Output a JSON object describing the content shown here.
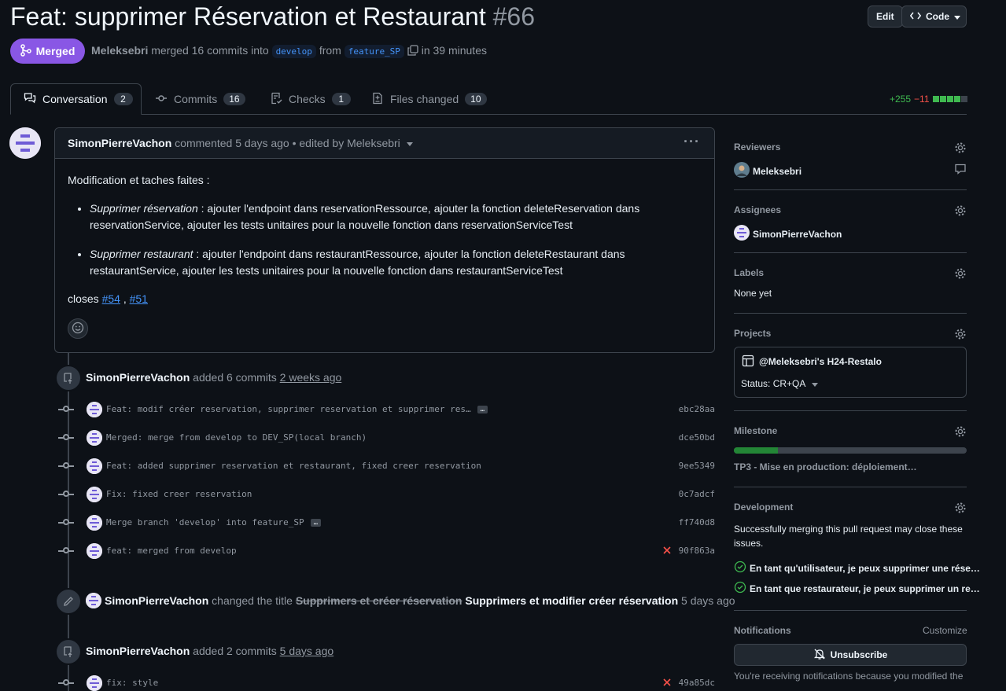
{
  "header": {
    "title": "Feat: supprimer Réservation et Restaurant",
    "number": "#66",
    "edit_label": "Edit",
    "code_label": "Code"
  },
  "merge": {
    "badge_label": "Merged",
    "author": "Meleksebri",
    "text_merged": "merged 16 commits into",
    "base_branch": "develop",
    "text_from": "from",
    "head_branch": "feature_SP",
    "text_duration": "in 39 minutes"
  },
  "tabs": [
    {
      "label": "Conversation",
      "count": "2"
    },
    {
      "label": "Commits",
      "count": "16"
    },
    {
      "label": "Checks",
      "count": "1"
    },
    {
      "label": "Files changed",
      "count": "10"
    }
  ],
  "diffstat": {
    "additions": "+255",
    "deletions": "−11",
    "color_add": "#3fb950",
    "color_del": "#f85149"
  },
  "comment": {
    "author": "SimonPierreVachon",
    "meta": "commented 5 days ago • edited by Meleksebri",
    "menu_label": "···",
    "intro": "Modification et taches faites :",
    "items": [
      {
        "em": "Supprimer réservation",
        "text": " : ajouter l'endpoint dans reservationRessource, ajouter la fonction deleteReservation dans reservationService, ajouter les tests unitaires pour la nouvelle fonction dans reservationServiceTest"
      },
      {
        "em": "Supprimer restaurant",
        "text": " : ajouter l'endpoint dans restaurantRessource, ajouter la fonction deleteRestaurant dans restaurantService, ajouter les tests unitaires pour la nouvelle fonction dans restaurantServiceTest"
      }
    ],
    "closes_label": "closes",
    "issue1": "#54",
    "separator": ",",
    "issue2": "#51"
  },
  "timeline": {
    "event1": {
      "author": "SimonPierreVachon",
      "action": "added 6 commits",
      "time": "2 weeks ago"
    },
    "commits": [
      {
        "msg": "Feat: modif créer reservation, supprimer reservation et supprimer res…",
        "sha": "ebc28aa",
        "ellipsis": true,
        "failed": false
      },
      {
        "msg": "Merged: merge from develop to DEV_SP(local branch)",
        "sha": "dce50bd",
        "ellipsis": false,
        "failed": false
      },
      {
        "msg": "Feat: added supprimer reservation et restaurant, fixed creer reservation",
        "sha": "9ee5349",
        "ellipsis": false,
        "failed": false
      },
      {
        "msg": "Fix: fixed creer reservation",
        "sha": "0c7adcf",
        "ellipsis": false,
        "failed": false
      },
      {
        "msg": "Merge branch 'develop' into feature_SP",
        "sha": "ff740d8",
        "ellipsis": true,
        "failed": false
      },
      {
        "msg": "feat: merged from develop",
        "sha": "90f863a",
        "ellipsis": false,
        "failed": true
      }
    ],
    "event2": {
      "author": "SimonPierreVachon",
      "action": "changed the title",
      "old_title": "Supprimers et créer réservation",
      "new_title": "Supprimers et modifier créer réservation",
      "time": "5 days ago"
    },
    "event3": {
      "author": "SimonPierreVachon",
      "action": "added 2 commits",
      "time": "5 days ago"
    },
    "commits2": [
      {
        "msg": "fix: style",
        "sha": "49a85dc",
        "failed": true
      }
    ]
  },
  "sidebar": {
    "reviewers": {
      "heading": "Reviewers",
      "name": "Meleksebri"
    },
    "assignees": {
      "heading": "Assignees",
      "name": "SimonPierreVachon"
    },
    "labels": {
      "heading": "Labels",
      "value": "None yet"
    },
    "projects": {
      "heading": "Projects",
      "project_name": "@Meleksebri's H24-Restalo",
      "status": "Status: CR+QA"
    },
    "milestone": {
      "heading": "Milestone",
      "name": "TP3 - Mise en production: déploiement…",
      "progress": 0.19
    },
    "development": {
      "heading": "Development",
      "description": "Successfully merging this pull request may close these issues.",
      "issues": [
        "En tant qu'utilisateur, je peux supprimer une rése…",
        "En tant que restaurateur, je peux supprimer un re…"
      ]
    },
    "notifications": {
      "heading": "Notifications",
      "customize_label": "Customize",
      "button_label": "Unsubscribe",
      "reason": "You're receiving notifications because you modified the"
    }
  }
}
